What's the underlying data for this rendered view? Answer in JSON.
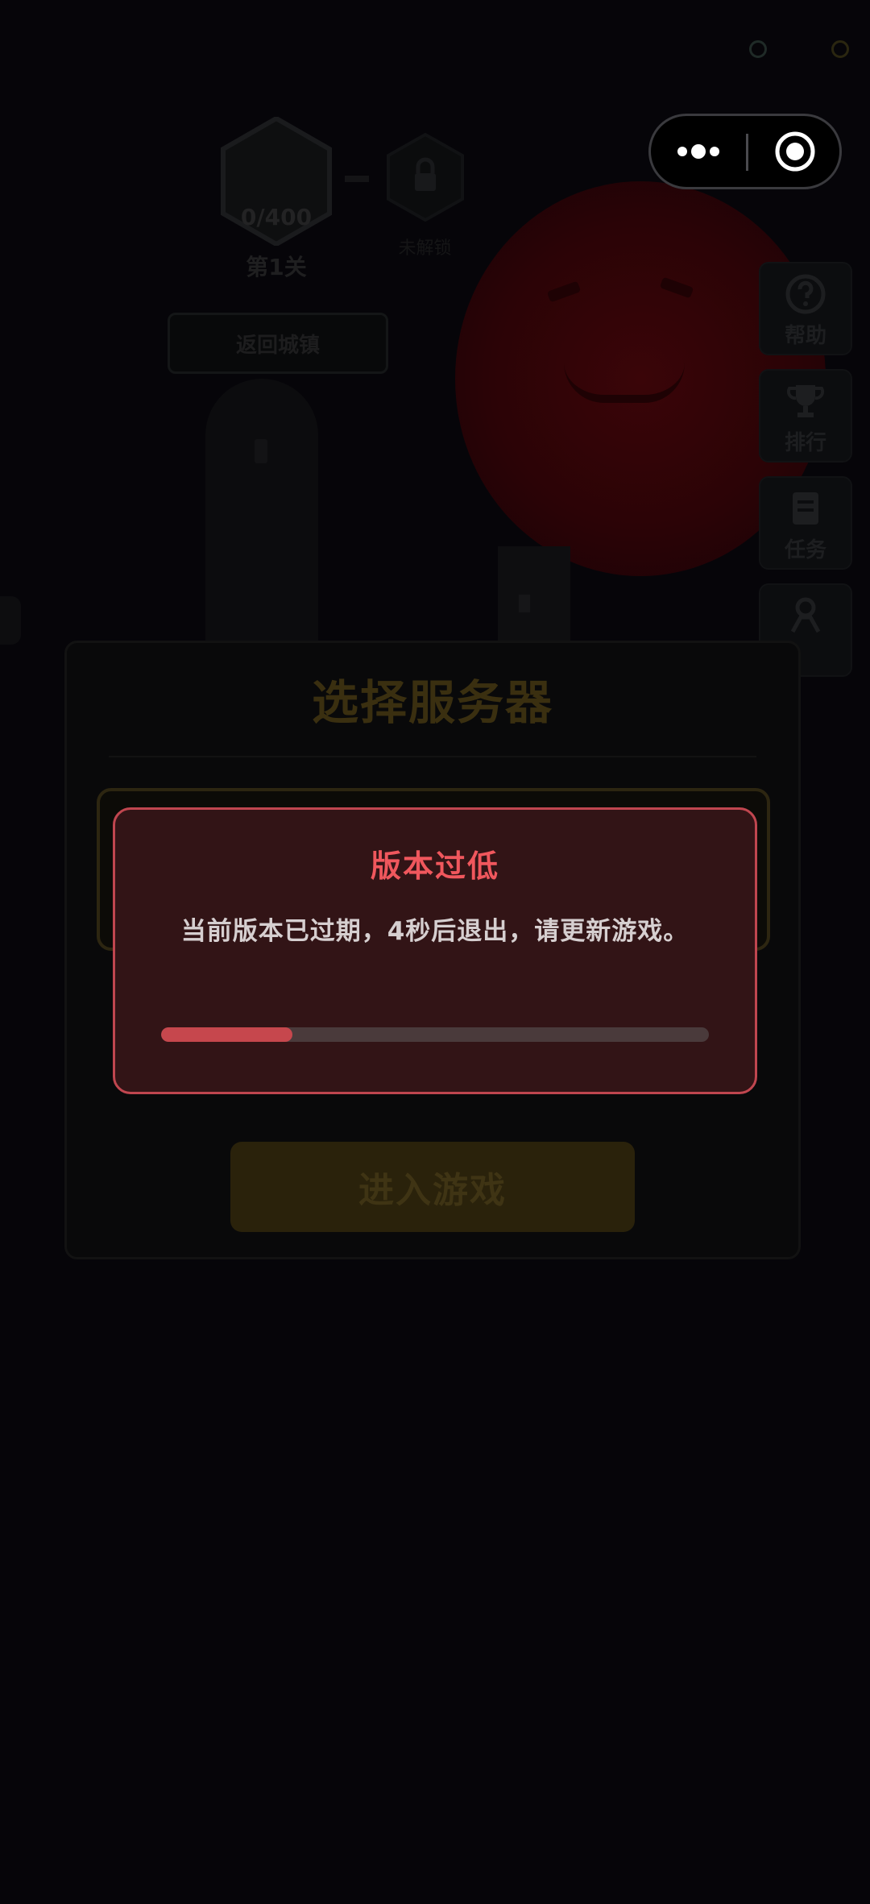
{
  "background": {
    "level": {
      "progress": "0/400",
      "name": "第1关"
    },
    "locked_label": "未解锁",
    "return_button": "返回城镇",
    "side_buttons": [
      {
        "label": "帮助",
        "icon": "help-icon"
      },
      {
        "label": "排行",
        "icon": "trophy-icon"
      },
      {
        "label": "任务",
        "icon": "task-icon"
      },
      {
        "label": "",
        "icon": "character-icon"
      }
    ]
  },
  "capsule": {
    "more_icon": "more-dots-icon",
    "close_icon": "target-close-icon"
  },
  "server_panel": {
    "title": "选择服务器",
    "enter_button": "进入游戏"
  },
  "dialog": {
    "title": "版本过低",
    "message": "当前版本已过期，4秒后退出，请更新游戏。",
    "countdown_progress": 0.24
  },
  "colors": {
    "dialog_border": "#c0464f",
    "dialog_title": "#f0575d",
    "progress_fill": "#c6474d",
    "panel_title_dim": "#3a2f10"
  }
}
